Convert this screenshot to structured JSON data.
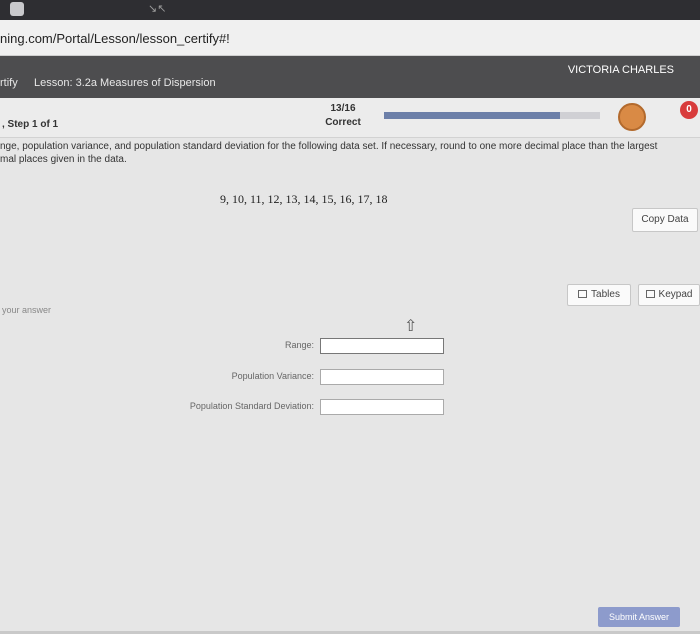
{
  "browser": {
    "url": "ning.com/Portal/Lesson/lesson_certify#!"
  },
  "header": {
    "crumb": "rtify",
    "lesson_title": "Lesson: 3.2a Measures of Dispersion",
    "user_name": "VICTORIA CHARLES"
  },
  "status": {
    "step": ", Step 1 of 1",
    "score": "13/16",
    "score_label": "Correct",
    "progress_fraction": 0.8125,
    "badge_count": "0"
  },
  "question": {
    "line1": "nge, population variance, and population standard deviation for the following data set. If necessary, round to one more decimal place than the largest",
    "line2": "mal places given in the data.",
    "dataset": "9, 10, 11, 12, 13, 14, 15, 16, 17, 18"
  },
  "buttons": {
    "copy_data": "Copy Data",
    "tables": "Tables",
    "keypad": "Keypad",
    "submit": "Submit Answer"
  },
  "answer": {
    "label": "your answer",
    "fields": [
      {
        "label": "Range:",
        "value": ""
      },
      {
        "label": "Population Variance:",
        "value": ""
      },
      {
        "label": "Population Standard Deviation:",
        "value": ""
      }
    ]
  },
  "colors": {
    "header_bg": "#4d4d4f",
    "progress_fill": "#6c7fa8",
    "badge_red": "#d83c3c",
    "medal_orange": "#d98a45",
    "submit_bg": "#8d9bcc"
  }
}
